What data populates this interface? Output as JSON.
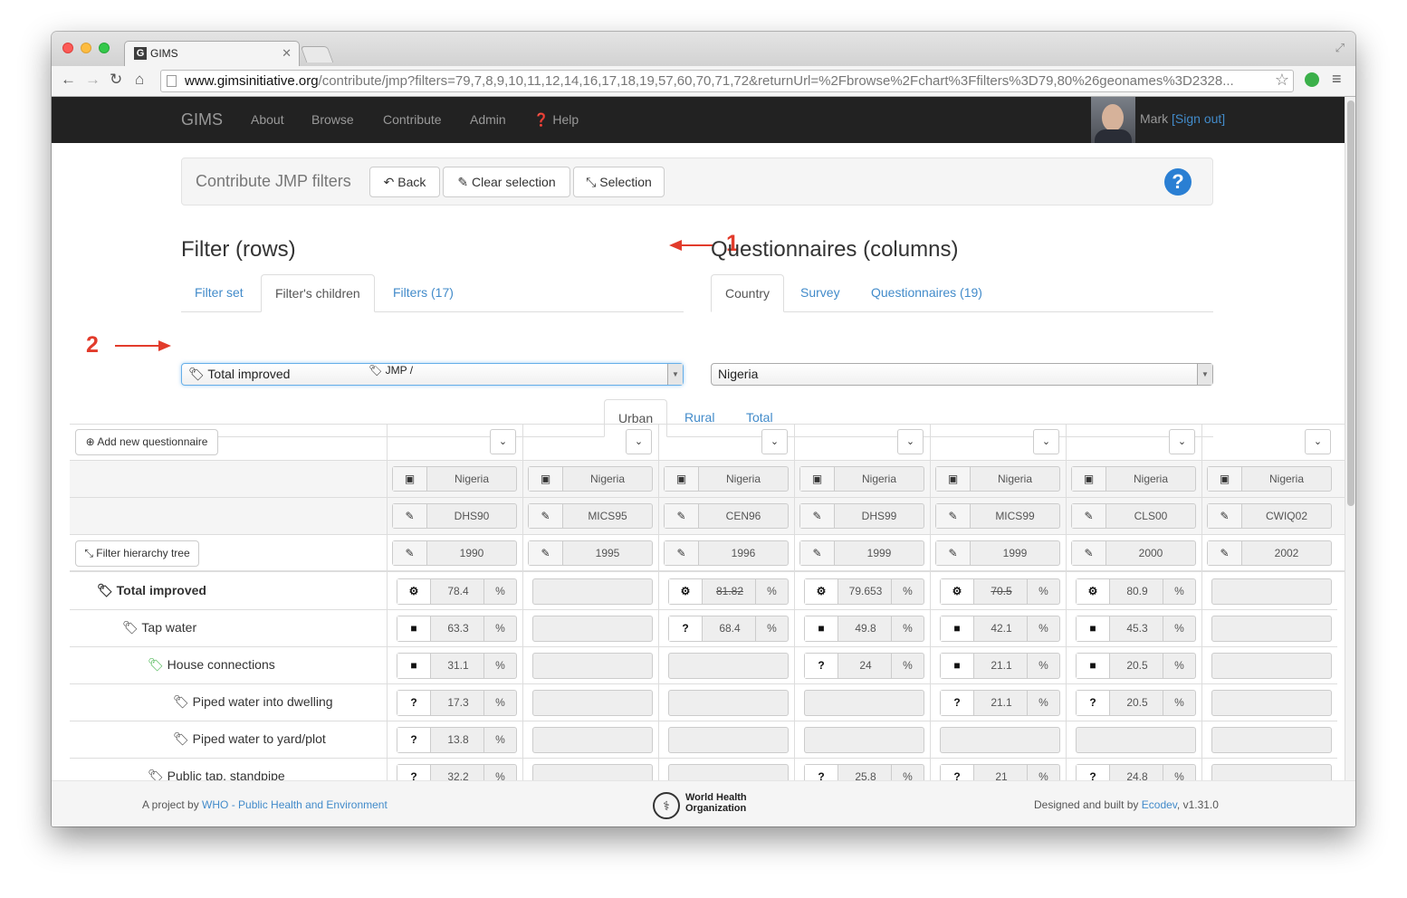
{
  "browser": {
    "tab_title": "GIMS",
    "tab_favicon": "G",
    "url_host": "www.gimsinitiative.org",
    "url_path": "/contribute/jmp?filters=79,7,8,9,10,11,12,14,16,17,18,19,57,60,70,71,72&returnUrl=%2Fbrowse%2Fchart%3Ffilters%3D79,80%26geonames%3D2328..."
  },
  "nav": {
    "brand": "GIMS",
    "links": [
      "About",
      "Browse",
      "Contribute",
      "Admin"
    ],
    "help": "Help",
    "user": "Mark",
    "signout": "[Sign out]"
  },
  "toolbar": {
    "title": "Contribute JMP filters",
    "back": "Back",
    "clear": "Clear selection",
    "selection": "Selection",
    "help_icon": "?"
  },
  "annotations": {
    "one": "1",
    "two": "2"
  },
  "filter_panel": {
    "heading": "Filter (rows)",
    "tabs": [
      "Filter set",
      "Filter's children",
      "Filters (17)"
    ],
    "active_tab": 1,
    "selected_filter": "Total improved",
    "selected_tag": "JMP /"
  },
  "questionnaire_panel": {
    "heading": "Questionnaires (columns)",
    "tabs": [
      "Country",
      "Survey",
      "Questionnaires (19)"
    ],
    "active_tab": 0,
    "country": "Nigeria"
  },
  "part_tabs": {
    "items": [
      "Urban",
      "Rural",
      "Total"
    ],
    "active": 0
  },
  "grid": {
    "add_questionnaire": "Add new questionnaire",
    "hierarchy_button": "Filter hierarchy tree",
    "columns": [
      {
        "country": "Nigeria",
        "survey": "DHS90",
        "year": "1990"
      },
      {
        "country": "Nigeria",
        "survey": "MICS95",
        "year": "1995"
      },
      {
        "country": "Nigeria",
        "survey": "CEN96",
        "year": "1996"
      },
      {
        "country": "Nigeria",
        "survey": "DHS99",
        "year": "1999"
      },
      {
        "country": "Nigeria",
        "survey": "MICS99",
        "year": "1999"
      },
      {
        "country": "Nigeria",
        "survey": "CLS00",
        "year": "2000"
      },
      {
        "country": "Nigeria",
        "survey": "CWIQ02",
        "year": "2002"
      }
    ],
    "unit": "%",
    "rows": [
      {
        "label": "Total improved",
        "level": 0,
        "bold": true,
        "color": "#333333",
        "cells": [
          {
            "icon": "gear",
            "value": "78.4"
          },
          null,
          {
            "icon": "gear",
            "value": "81.82",
            "strike": true
          },
          {
            "icon": "gear",
            "value": "79.653"
          },
          {
            "icon": "gear",
            "value": "70.5",
            "strike": true
          },
          {
            "icon": "gear",
            "value": "80.9"
          },
          null
        ]
      },
      {
        "label": "Tap water",
        "level": 1,
        "color": "#333333",
        "cells": [
          {
            "icon": "folder",
            "value": "63.3"
          },
          null,
          {
            "icon": "question",
            "value": "68.4"
          },
          {
            "icon": "folder",
            "value": "49.8"
          },
          {
            "icon": "folder",
            "value": "42.1"
          },
          {
            "icon": "folder",
            "value": "45.3"
          },
          null
        ]
      },
      {
        "label": "House connections",
        "level": 2,
        "color": "#3cb043",
        "cells": [
          {
            "icon": "folder",
            "value": "31.1"
          },
          null,
          null,
          {
            "icon": "question",
            "value": "24"
          },
          {
            "icon": "folder",
            "value": "21.1"
          },
          {
            "icon": "folder",
            "value": "20.5"
          },
          null
        ]
      },
      {
        "label": "Piped water into dwelling",
        "level": 3,
        "color": "#333333",
        "cells": [
          {
            "icon": "question",
            "value": "17.3"
          },
          null,
          null,
          null,
          {
            "icon": "question",
            "value": "21.1"
          },
          {
            "icon": "question",
            "value": "20.5"
          },
          null
        ]
      },
      {
        "label": "Piped water to yard/plot",
        "level": 3,
        "color": "#333333",
        "cells": [
          {
            "icon": "question",
            "value": "13.8"
          },
          null,
          null,
          null,
          null,
          null,
          null
        ]
      },
      {
        "label": "Public tap, standpipe",
        "level": 2,
        "color": "#333333",
        "cells": [
          {
            "icon": "question",
            "value": "32.2"
          },
          null,
          null,
          {
            "icon": "question",
            "value": "25.8"
          },
          {
            "icon": "question",
            "value": "21"
          },
          {
            "icon": "question",
            "value": "24.8"
          },
          null
        ]
      }
    ]
  },
  "footer": {
    "left_prefix": "A project by",
    "left_link": "WHO - Public Health and Environment",
    "who_line1": "World Health",
    "who_line2": "Organization",
    "right_prefix": "Designed and built by",
    "right_link": "Ecodev",
    "version": ", v1.31.0"
  }
}
